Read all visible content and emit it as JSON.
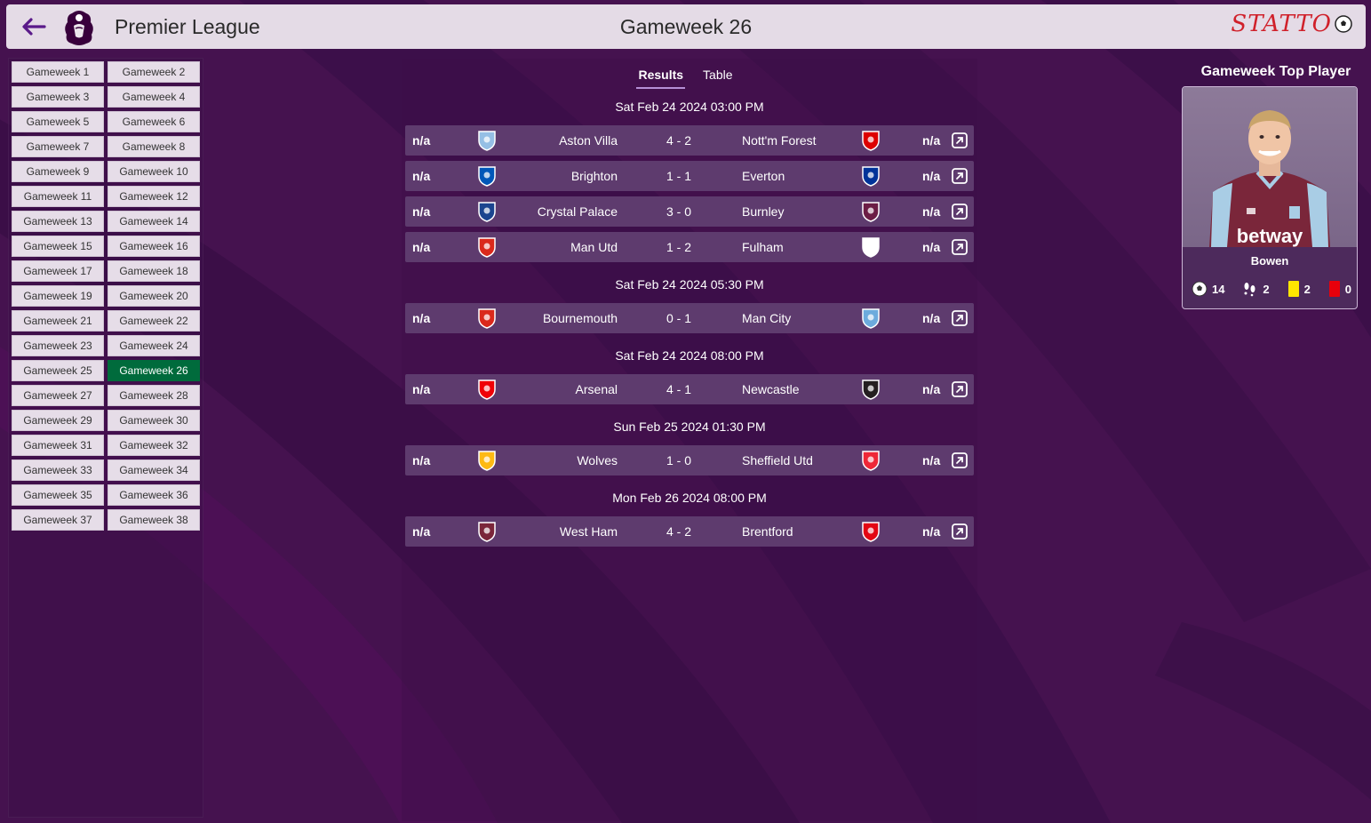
{
  "header": {
    "league_title": "Premier League",
    "gameweek_title": "Gameweek 26",
    "brand": "STATTO"
  },
  "gameweeks": [
    "Gameweek 1",
    "Gameweek 2",
    "Gameweek 3",
    "Gameweek 4",
    "Gameweek 5",
    "Gameweek 6",
    "Gameweek 7",
    "Gameweek 8",
    "Gameweek 9",
    "Gameweek 10",
    "Gameweek 11",
    "Gameweek 12",
    "Gameweek 13",
    "Gameweek 14",
    "Gameweek 15",
    "Gameweek 16",
    "Gameweek 17",
    "Gameweek 18",
    "Gameweek 19",
    "Gameweek 20",
    "Gameweek 21",
    "Gameweek 22",
    "Gameweek 23",
    "Gameweek 24",
    "Gameweek 25",
    "Gameweek 26",
    "Gameweek 27",
    "Gameweek 28",
    "Gameweek 29",
    "Gameweek 30",
    "Gameweek 31",
    "Gameweek 32",
    "Gameweek 33",
    "Gameweek 34",
    "Gameweek 35",
    "Gameweek 36",
    "Gameweek 37",
    "Gameweek 38"
  ],
  "active_gameweek": "Gameweek 26",
  "tabs": {
    "results": "Results",
    "table": "Table"
  },
  "dates": [
    "Sat Feb 24 2024 03:00 PM",
    "Sat Feb 24 2024 05:30 PM",
    "Sat Feb 24 2024 08:00 PM",
    "Sun Feb 25 2024 01:30 PM",
    "Mon Feb 26 2024 08:00 PM"
  ],
  "matches": [
    {
      "home_rating": "n/a",
      "home": "Aston Villa",
      "score": "4 - 2",
      "away": "Nott'm Forest",
      "away_rating": "n/a",
      "home_color": "#95bfe5",
      "away_color": "#dd0000"
    },
    {
      "home_rating": "n/a",
      "home": "Brighton",
      "score": "1 - 1",
      "away": "Everton",
      "away_rating": "n/a",
      "home_color": "#0057b8",
      "away_color": "#003399"
    },
    {
      "home_rating": "n/a",
      "home": "Crystal Palace",
      "score": "3 - 0",
      "away": "Burnley",
      "away_rating": "n/a",
      "home_color": "#1b458f",
      "away_color": "#6c1d45"
    },
    {
      "home_rating": "n/a",
      "home": "Man Utd",
      "score": "1 - 2",
      "away": "Fulham",
      "away_rating": "n/a",
      "home_color": "#da291c",
      "away_color": "#ffffff"
    },
    {
      "home_rating": "n/a",
      "home": "Bournemouth",
      "score": "0 - 1",
      "away": "Man City",
      "away_rating": "n/a",
      "home_color": "#da291c",
      "away_color": "#6cabdd"
    },
    {
      "home_rating": "n/a",
      "home": "Arsenal",
      "score": "4 - 1",
      "away": "Newcastle",
      "away_rating": "n/a",
      "home_color": "#ef0107",
      "away_color": "#241f20"
    },
    {
      "home_rating": "n/a",
      "home": "Wolves",
      "score": "1 - 0",
      "away": "Sheffield Utd",
      "away_rating": "n/a",
      "home_color": "#fdb913",
      "away_color": "#ee2737"
    },
    {
      "home_rating": "n/a",
      "home": "West Ham",
      "score": "4 - 2",
      "away": "Brentford",
      "away_rating": "n/a",
      "home_color": "#7a263a",
      "away_color": "#e30613"
    }
  ],
  "top_player": {
    "title": "Gameweek Top Player",
    "name": "Bowen",
    "points": "14",
    "assists": "2",
    "yellow": "2",
    "red": "0",
    "sponsor": "betway"
  }
}
